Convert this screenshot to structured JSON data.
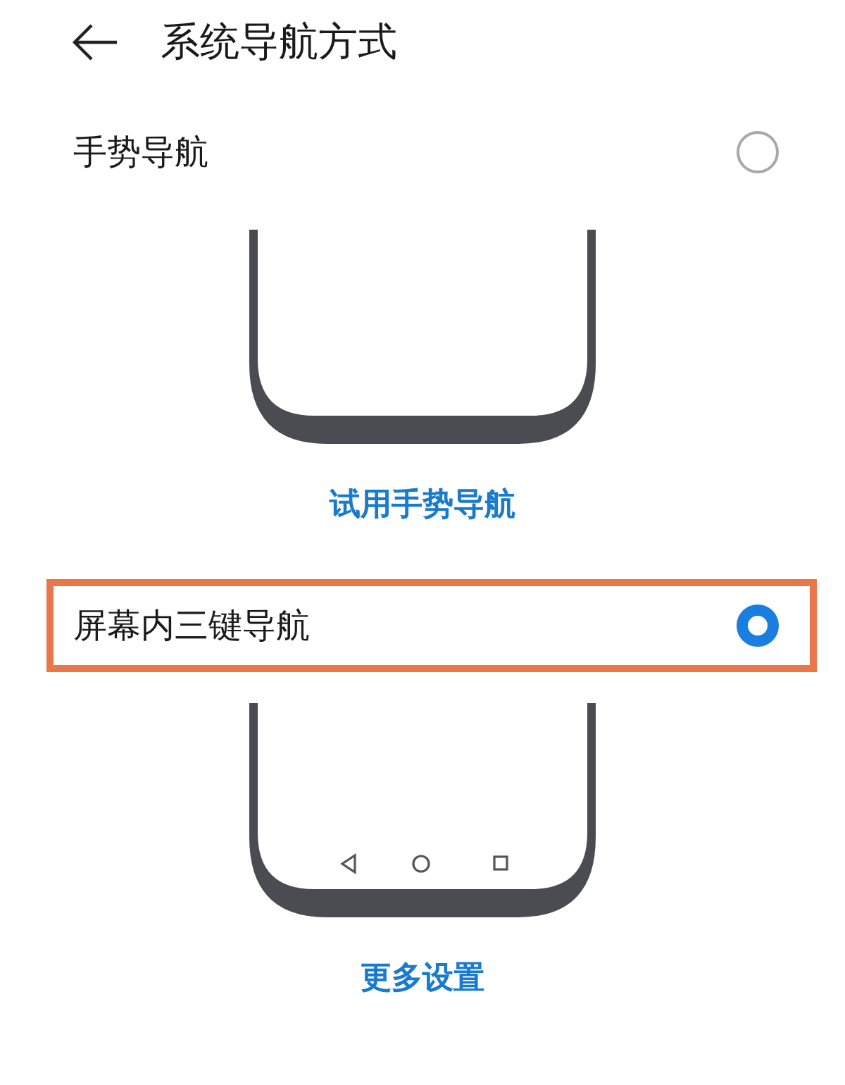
{
  "header": {
    "title": "系统导航方式"
  },
  "options": [
    {
      "label": "手势导航",
      "selected": false,
      "highlighted": false,
      "kind": "gesture",
      "link": "试用手势导航"
    },
    {
      "label": "屏幕内三键导航",
      "selected": true,
      "highlighted": true,
      "kind": "three-key",
      "link": "更多设置"
    }
  ]
}
